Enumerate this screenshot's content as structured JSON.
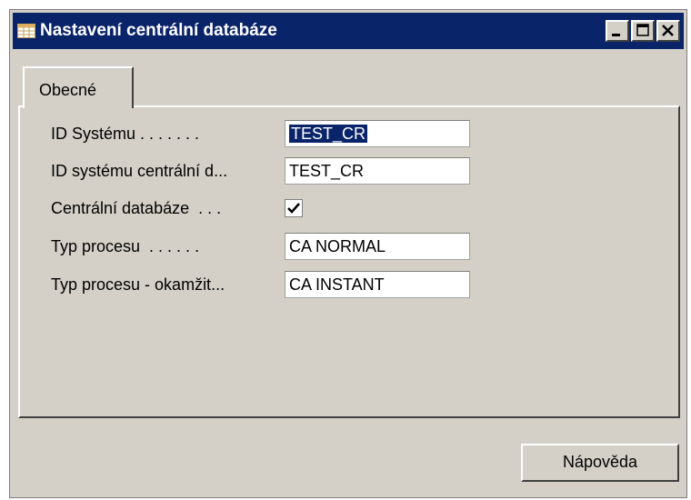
{
  "window": {
    "title": "Nastavení centrální databáze",
    "title_icon": "table-icon",
    "controls": [
      "minimize-icon",
      "maximize-icon",
      "close-icon"
    ]
  },
  "tabs": [
    {
      "label": "Obecné",
      "active": true
    }
  ],
  "fields": [
    {
      "label": "ID Systému . . . . . . .",
      "value": "TEST_CR",
      "selected": true
    },
    {
      "label": "ID systému centrální d...",
      "value": "TEST_CR"
    },
    {
      "label": "Centrální databáze  . . .",
      "checked": true
    },
    {
      "label": "Typ procesu  . . . . . .",
      "value": "CA NORMAL"
    },
    {
      "label": "Typ procesu - okamžit...",
      "value": "CA INSTANT"
    }
  ],
  "buttons": {
    "help_label": "Nápověda"
  }
}
